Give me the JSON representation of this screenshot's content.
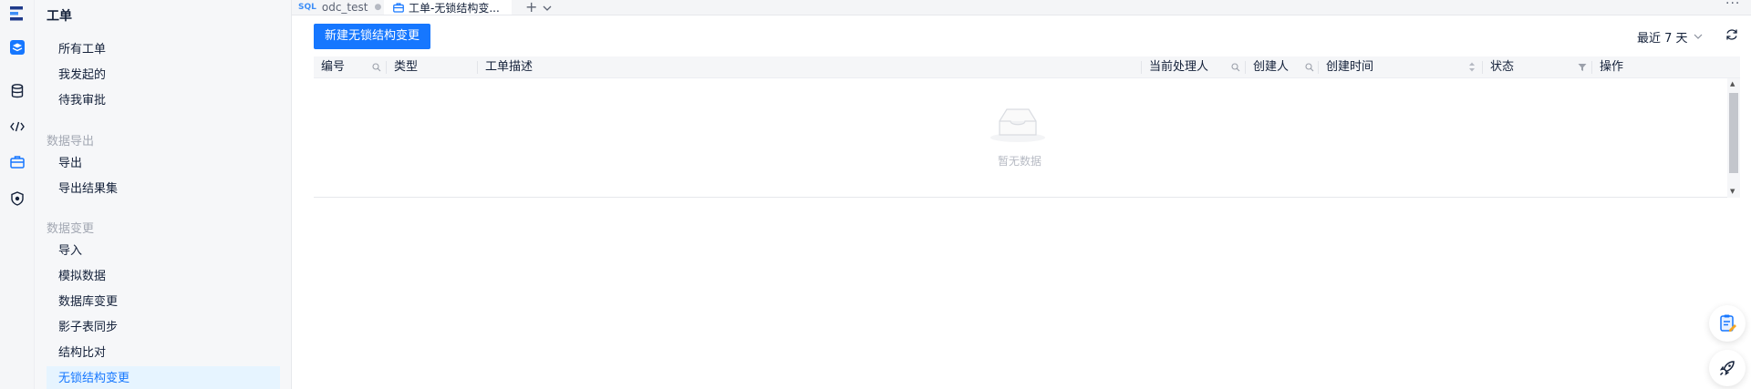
{
  "sidebar": {
    "title": "工单",
    "groups": [
      {
        "label": "数据导出"
      },
      {
        "label": "数据变更"
      }
    ],
    "items": [
      {
        "label": "所有工单"
      },
      {
        "label": "我发起的"
      },
      {
        "label": "待我审批"
      },
      {
        "label": "导出"
      },
      {
        "label": "导出结果集"
      },
      {
        "label": "导入"
      },
      {
        "label": "模拟数据"
      },
      {
        "label": "数据库变更"
      },
      {
        "label": "影子表同步"
      },
      {
        "label": "结构比对"
      },
      {
        "label": "无锁结构变更"
      }
    ]
  },
  "rail": {
    "icons": [
      "logo-icon",
      "layers-icon",
      "database-icon",
      "code-icon",
      "briefcase-icon",
      "shield-icon"
    ]
  },
  "tabs": [
    {
      "prefix": "SQL",
      "label": "odc_test"
    },
    {
      "label": "工单-无锁结构变..."
    }
  ],
  "toolbar": {
    "new_button": "新建无锁结构变更",
    "range": "最近 7 天"
  },
  "table": {
    "columns": [
      "编号",
      "类型",
      "工单描述",
      "当前处理人",
      "创建人",
      "创建时间",
      "状态",
      "操作"
    ],
    "empty_text": "暂无数据"
  },
  "colors": {
    "accent": "#1677ff",
    "active_bg": "#e6f4ff"
  }
}
